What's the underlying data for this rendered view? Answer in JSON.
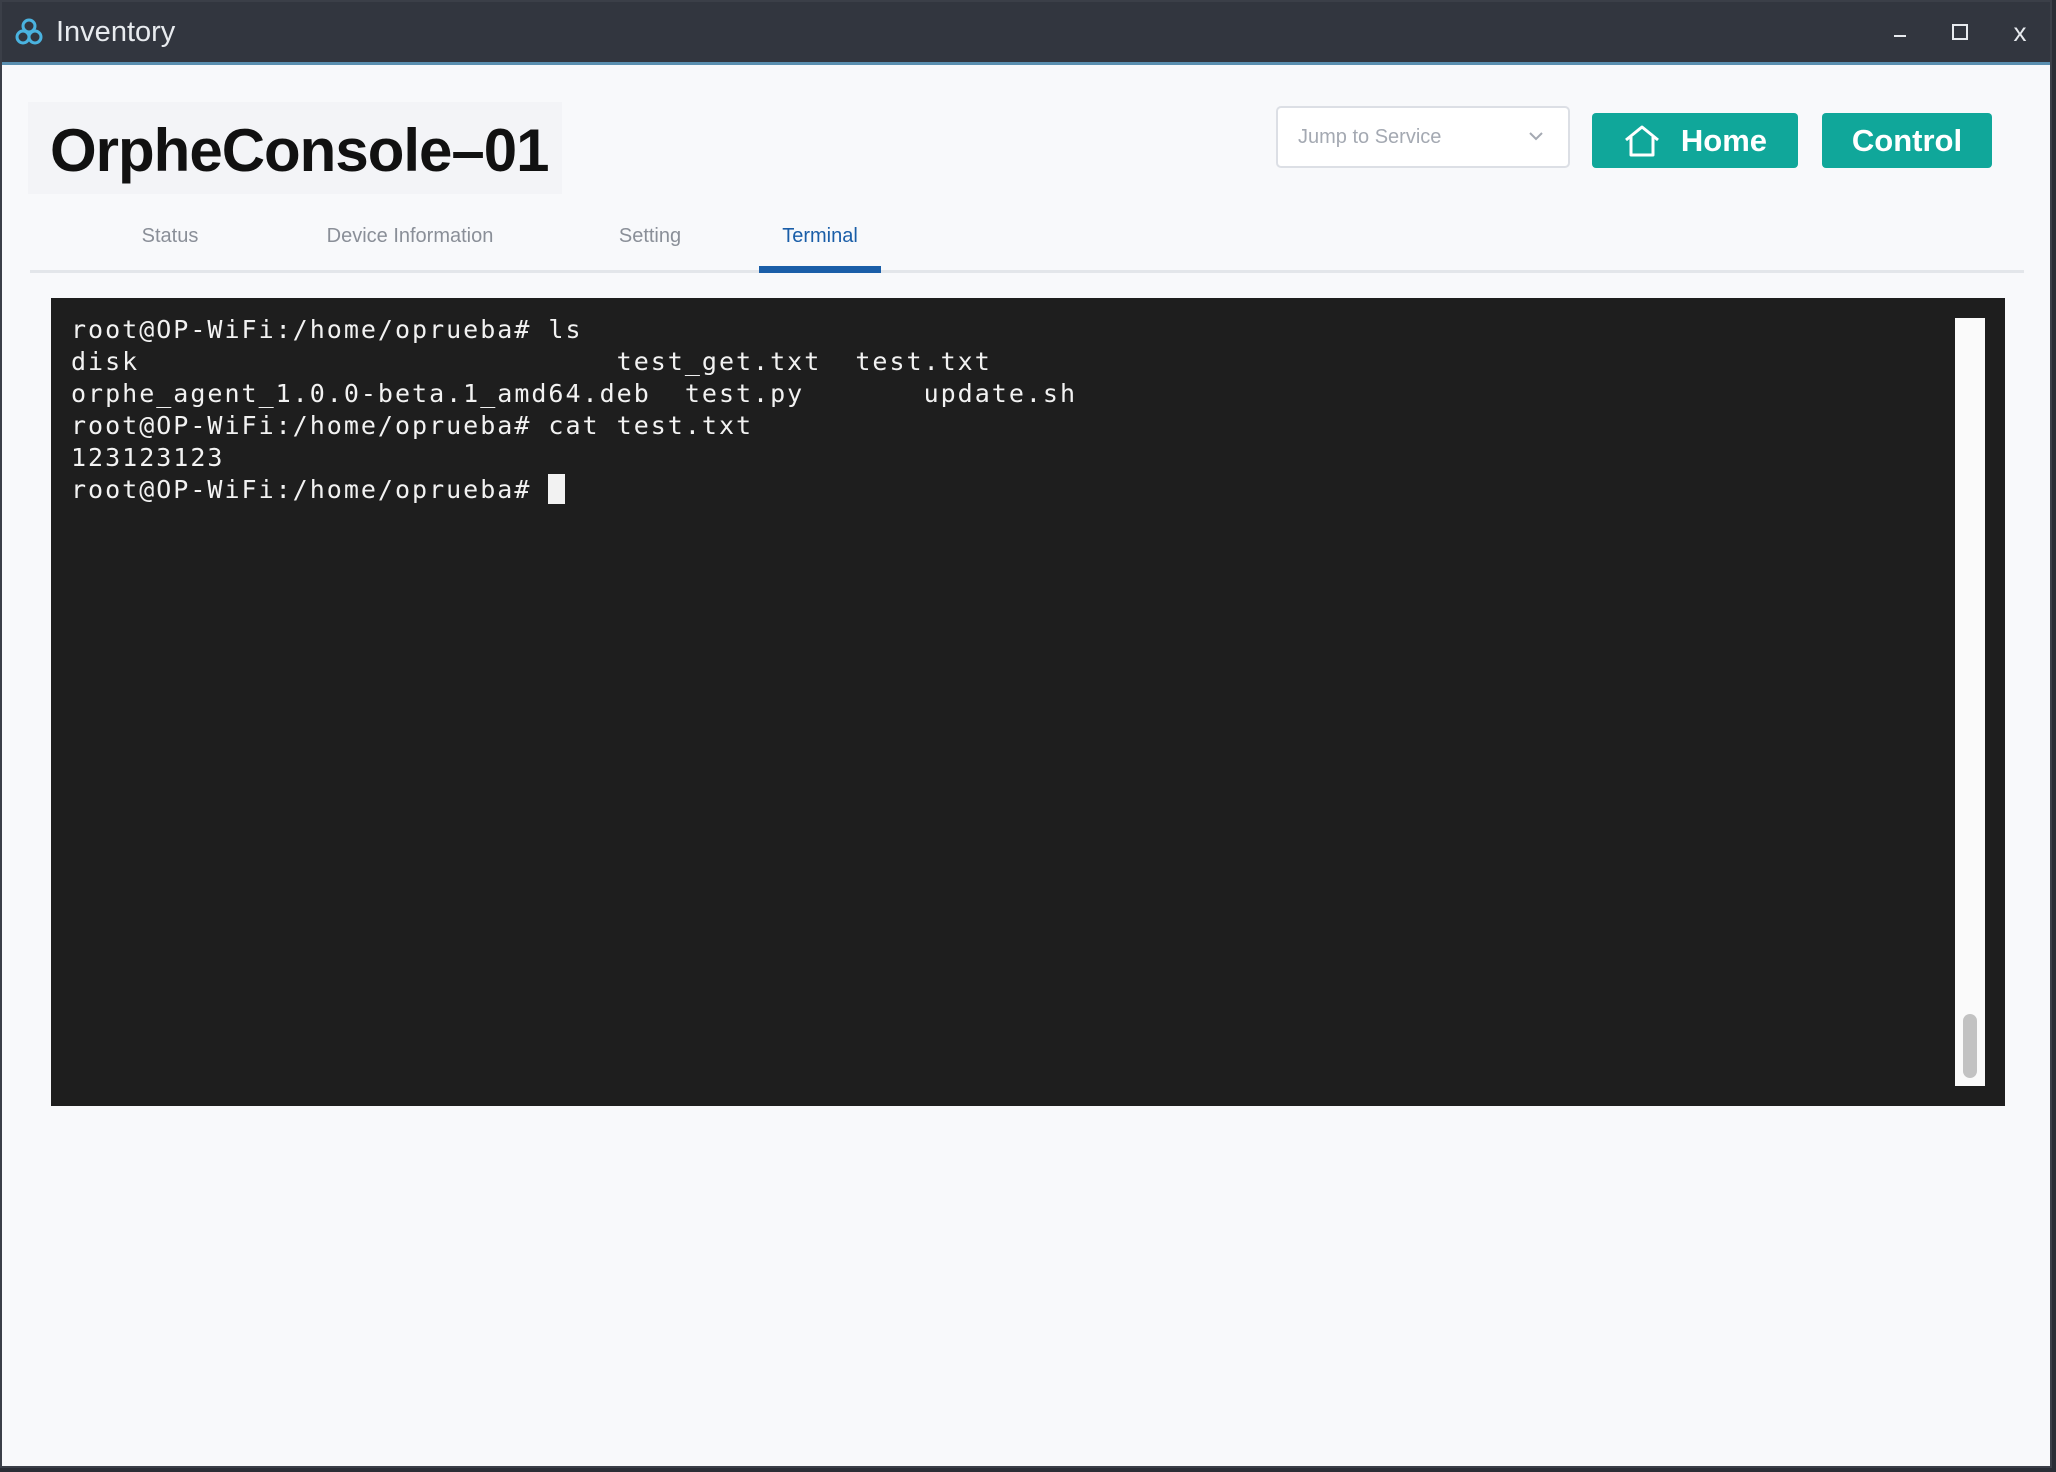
{
  "window": {
    "title": "Inventory",
    "icon": "app-logo-icon",
    "controls": {
      "minimize": "–",
      "maximize": "☐",
      "close": "x"
    }
  },
  "header": {
    "device_name": "OrpheConsole–01",
    "jump_select": {
      "placeholder": "Jump to Service",
      "icon": "chevron-down-icon"
    },
    "home_button": {
      "label": "Home",
      "icon": "home-icon"
    },
    "control_button": {
      "label": "Control"
    }
  },
  "tabs": [
    {
      "label": "Status",
      "active": false
    },
    {
      "label": "Device Information",
      "active": false
    },
    {
      "label": "Setting",
      "active": false
    },
    {
      "label": "Terminal",
      "active": true
    }
  ],
  "terminal": {
    "lines": [
      "root@OP-WiFi:/home/oprueba# ls",
      "disk                            test_get.txt  test.txt",
      "orphe_agent_1.0.0-beta.1_amd64.deb  test.py       update.sh",
      "root@OP-WiFi:/home/oprueba# cat test.txt",
      "123123123"
    ],
    "prompt": "root@OP-WiFi:/home/oprueba# "
  },
  "colors": {
    "accent": "#10a79a",
    "tab_active": "#1a5ea8",
    "terminal_bg": "#1e1e1e",
    "titlebar_bg": "#32363f"
  }
}
